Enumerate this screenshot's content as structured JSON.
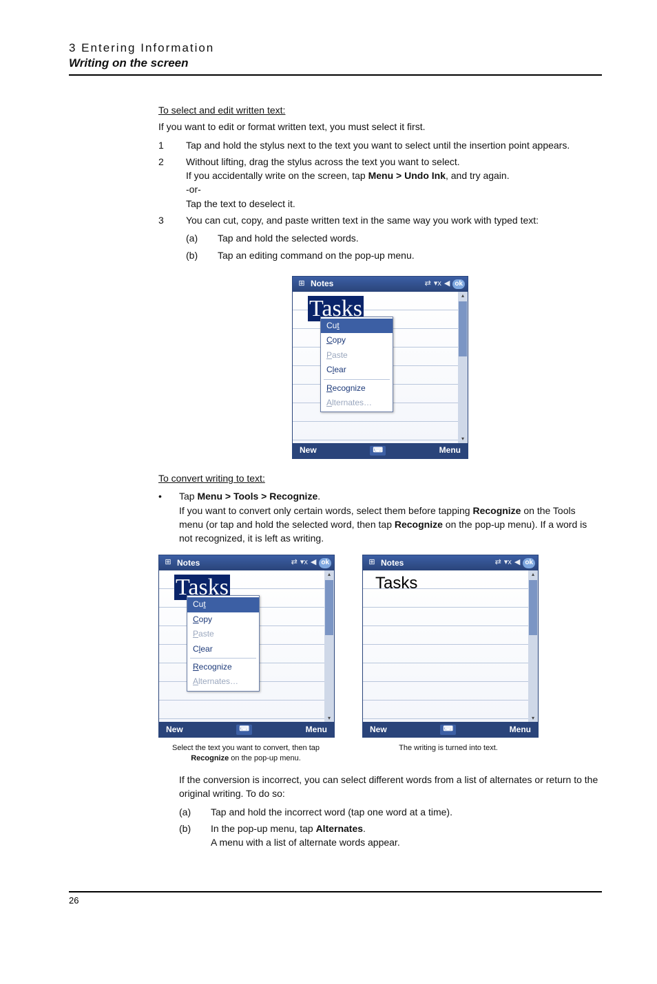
{
  "header": {
    "chapter": "3 Entering Information",
    "section": "Writing on the screen"
  },
  "body": {
    "h1": "To select and edit written text:",
    "intro": "If you want to edit or format written text, you must select it first.",
    "step1_n": "1",
    "step1": "Tap and hold the stylus next to the text you want to select until the insertion point appears.",
    "step2_n": "2",
    "step2a": "Without lifting, drag the stylus across the text you want to select.",
    "step2b_pre": "If you accidentally write on the screen, tap ",
    "step2b_bold": "Menu > Undo Ink",
    "step2b_post": ", and try again.",
    "step2c": "-or-",
    "step2d": "Tap the text to deselect it.",
    "step3_n": "3",
    "step3": "You can cut, copy, and paste written text in the same way you work with typed text:",
    "step3a_n": "(a)",
    "step3a": "Tap and hold the selected words.",
    "step3b_n": "(b)",
    "step3b": "Tap an editing command on the pop-up menu.",
    "h2": "To convert writing to text:",
    "bullet": "•",
    "conv_pre": "Tap ",
    "conv_bold": "Menu > Tools > Recognize",
    "conv_post": ".",
    "conv_para_pre": " If you want to convert only certain words, select them before tapping ",
    "conv_para_bold1": "Recognize",
    "conv_para_mid": " on the Tools menu (or tap and hold the selected word, then tap ",
    "conv_para_bold2": "Recognize",
    "conv_para_post": " on the pop-up menu). If a word is not recognized, it is left as writing.",
    "cap1_pre": "Select the text you want to convert, then tap ",
    "cap1_bold": "Recognize",
    "cap1_post": " on the pop-up menu.",
    "cap2": "The writing is turned into text.",
    "afterfig": " If the conversion is incorrect, you can select different words from a list of alternates or return to the original writing. To do so:",
    "af_a_n": "(a)",
    "af_a": "Tap and hold the incorrect word (tap one word at a time).",
    "af_b_n": "(b)",
    "af_b_pre": "In the pop-up menu, tap ",
    "af_b_bold": "Alternates",
    "af_b_post": ".",
    "af_b2": "A menu with a list of alternate words appear."
  },
  "screenshot": {
    "title": "Notes",
    "ok": "ok",
    "new": "New",
    "menu": "Menu",
    "handwriting": "Tasks",
    "typed": "Tasks",
    "ctx_cut": "Cut",
    "ctx_copy": "Copy",
    "ctx_paste": "Paste",
    "ctx_clear": "Clear",
    "ctx_recognize": "Recognize",
    "ctx_alternates": "Alternates…"
  },
  "page_number": "26"
}
